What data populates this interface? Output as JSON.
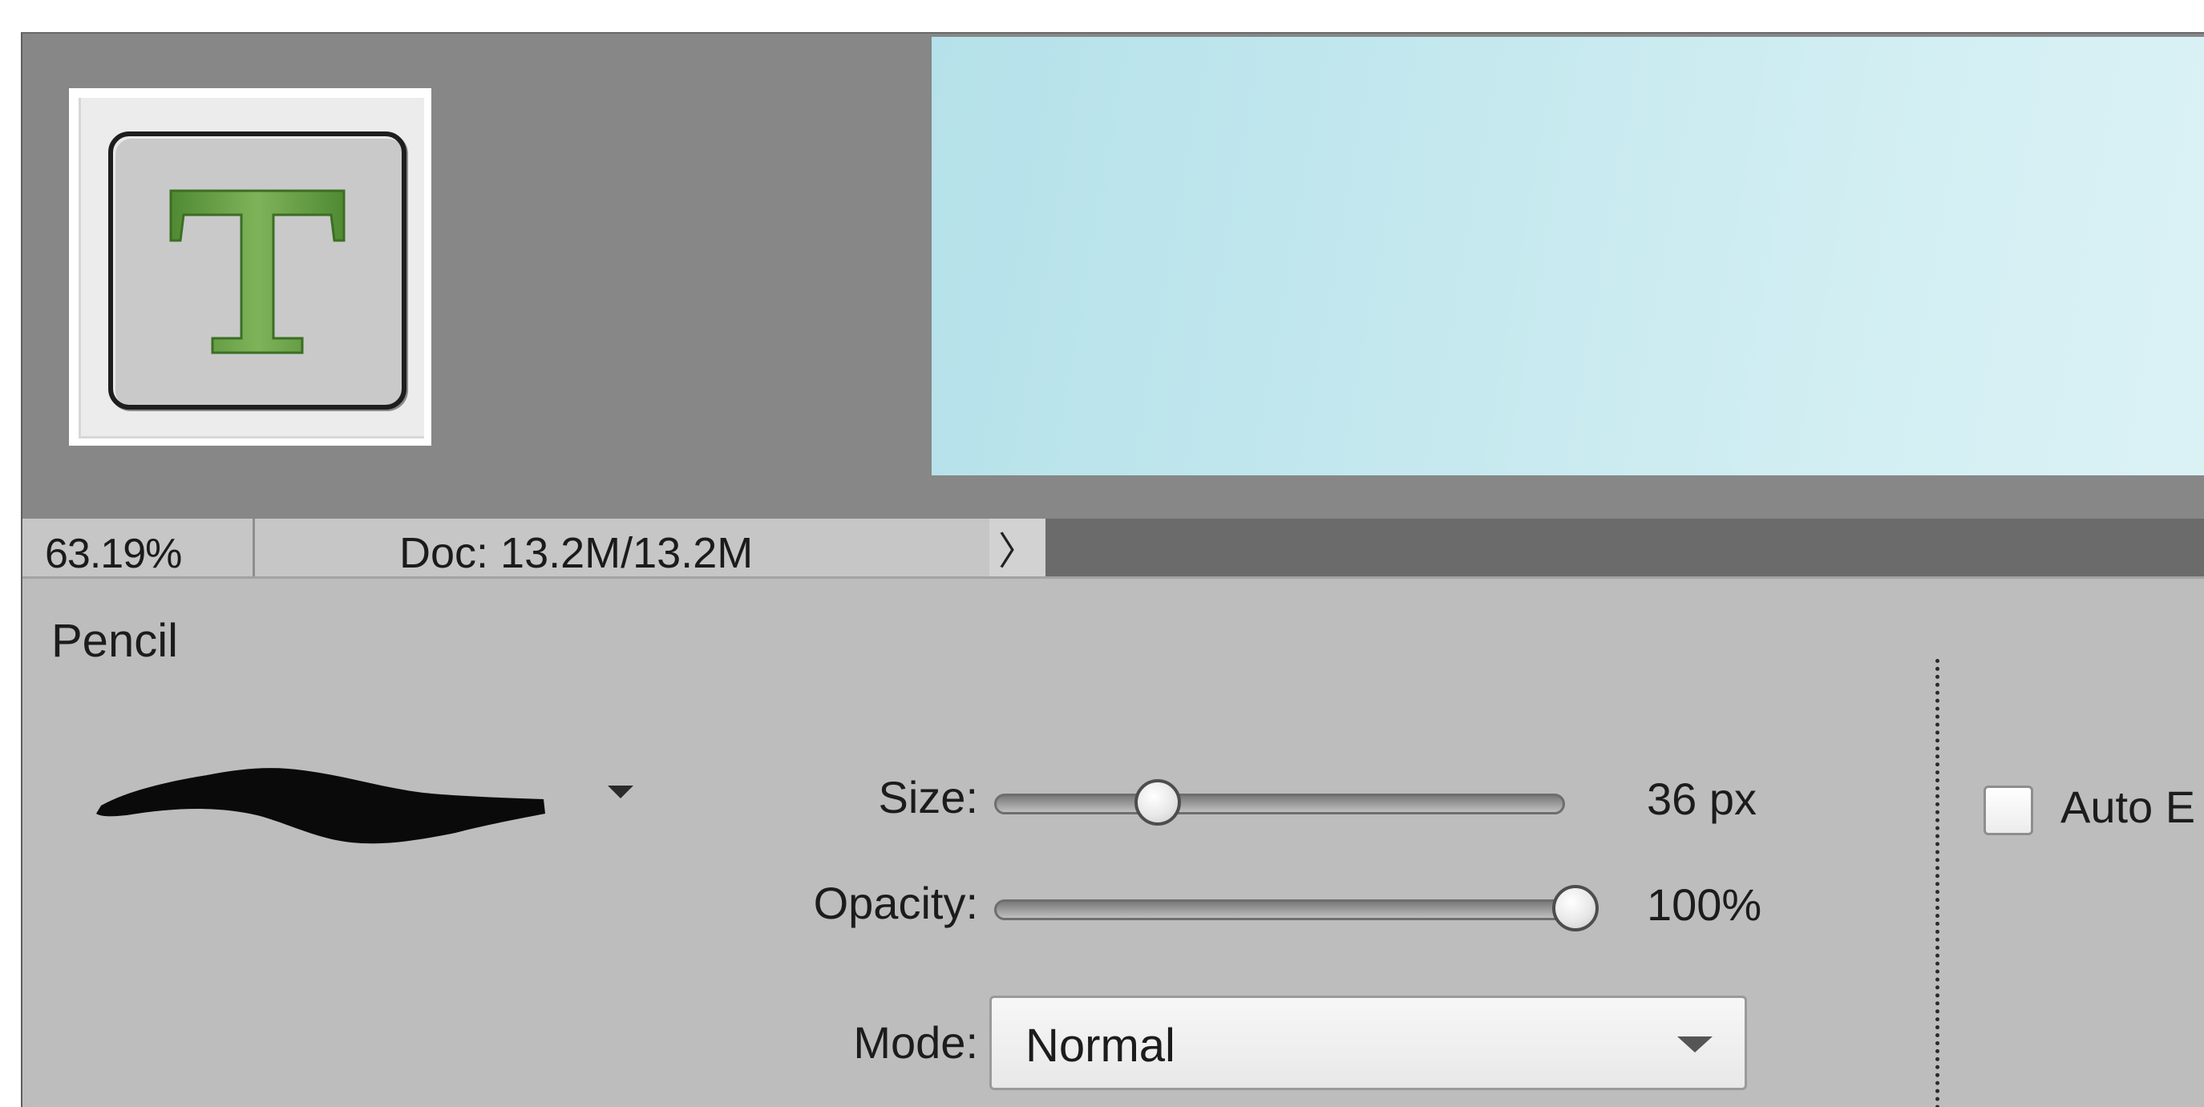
{
  "tool_preview": {
    "icon": "type-tool-icon",
    "glyph": "T",
    "glyph_color": "#5c9a3c"
  },
  "canvas": {
    "colors": [
      "#b5e1ea",
      "#dbf2f5"
    ]
  },
  "status_bar": {
    "zoom": "63.19%",
    "doc_info": "Doc: 13.2M/13.2M",
    "arrow_icon": "chevron-right-icon",
    "arrow_glyph": "〉"
  },
  "options": {
    "tool_name": "Pencil",
    "brush_icon": "brush-stroke-icon",
    "size": {
      "label": "Size:",
      "value_text": "36 px",
      "fraction": 0.27
    },
    "opacity": {
      "label": "Opacity:",
      "value_text": "100%",
      "fraction": 1.0
    },
    "mode": {
      "label": "Mode:",
      "selected": "Normal"
    },
    "auto_erase": {
      "label": "Auto E",
      "checked": false
    }
  }
}
